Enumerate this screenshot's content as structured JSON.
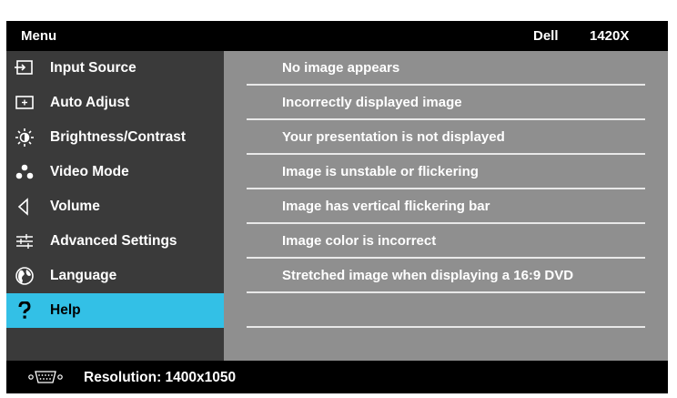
{
  "header": {
    "title": "Menu",
    "brand": "Dell",
    "model": "1420X"
  },
  "sidebar": {
    "items": [
      {
        "label": "Input Source",
        "icon": "input-source-icon"
      },
      {
        "label": "Auto Adjust",
        "icon": "auto-adjust-icon"
      },
      {
        "label": "Brightness/Contrast",
        "icon": "brightness-icon"
      },
      {
        "label": "Video Mode",
        "icon": "video-mode-icon"
      },
      {
        "label": "Volume",
        "icon": "volume-icon"
      },
      {
        "label": "Advanced Settings",
        "icon": "advanced-settings-icon"
      },
      {
        "label": "Language",
        "icon": "globe-icon"
      },
      {
        "label": "Help",
        "icon": "help-icon",
        "selected": true
      }
    ]
  },
  "help_topics": [
    "No image appears",
    "Incorrectly displayed image",
    "Your presentation is not displayed",
    "Image is unstable or flickering",
    "Image has vertical flickering bar",
    "Image color is incorrect",
    "Stretched image when displaying a 16:9 DVD",
    ""
  ],
  "footer": {
    "resolution": "Resolution: 1400x1050",
    "icon": "vga-connector-icon"
  },
  "colors": {
    "selected": "#33c0e6",
    "sidebar_bg": "#3a3a3a",
    "content_bg": "#8f8f8f",
    "frame": "#000000"
  }
}
